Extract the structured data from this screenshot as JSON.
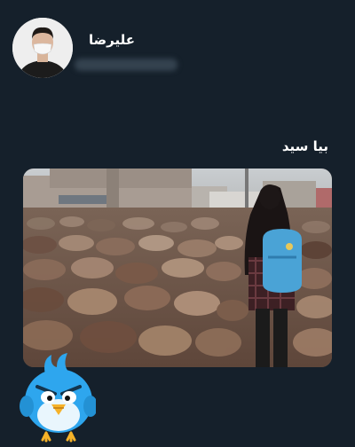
{
  "profile": {
    "display_name": "علیرضا",
    "avatar_icon": "user-avatar-masked-man",
    "handle_blurred": true
  },
  "tweet": {
    "text": "بیا سید",
    "media": {
      "type": "photo",
      "description_icon": "sheep-flock-photo"
    }
  },
  "overlay": {
    "sticker_icon": "angry-blue-twitter-bird-icon"
  },
  "colors": {
    "background": "#15202b",
    "text": "#ffffff",
    "bird_blue": "#2ea6ee"
  }
}
